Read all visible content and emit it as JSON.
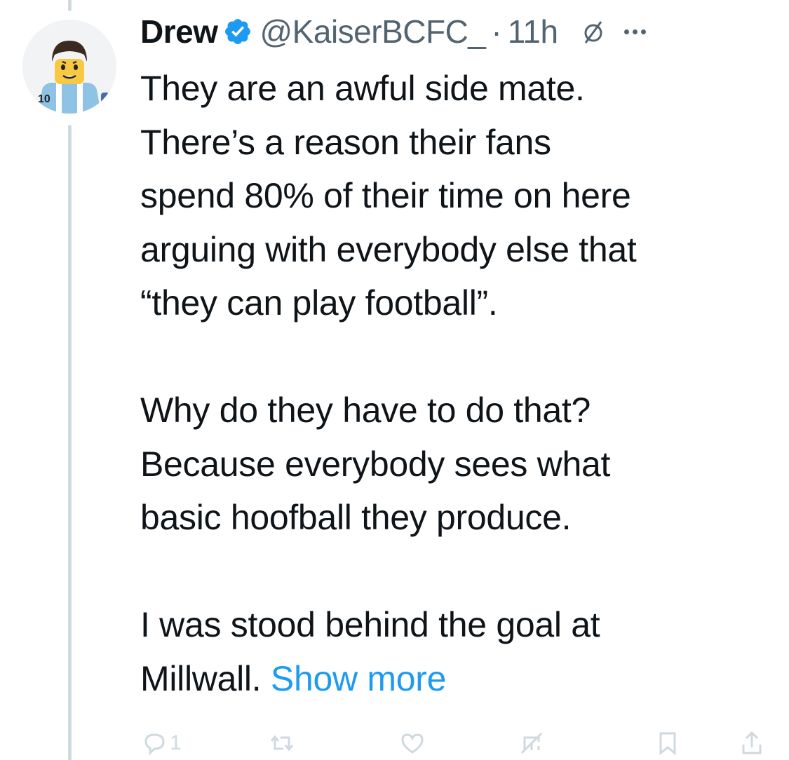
{
  "tweet": {
    "author": {
      "name": "Drew",
      "handle": "@KaiserBCFC_",
      "verified": true,
      "avatar_icon": "lego-minifigure-avatar"
    },
    "separator": "·",
    "time": "11h",
    "lines": [
      "They are an awful side mate.",
      "There’s a reason their fans",
      "spend 80% of their time on here",
      "arguing with everybody else that",
      "“they can play football”."
    ],
    "lines2": [
      "Why do they have to do that?",
      "Because everybody sees what",
      "basic hoofball they produce."
    ],
    "lines3_a": "I was stood behind the goal at",
    "lines3_b": "Millwall.",
    "show_more": "Show more",
    "actions": {
      "reply_count": "1",
      "icons": [
        "reply-icon",
        "retweet-icon",
        "like-icon",
        "analytics-icon",
        "bookmark-icon",
        "share-icon"
      ]
    }
  },
  "colors": {
    "text": "#0f1419",
    "secondary": "#536471",
    "accent": "#1d9bf0",
    "muted_icon": "#cfd9de"
  }
}
